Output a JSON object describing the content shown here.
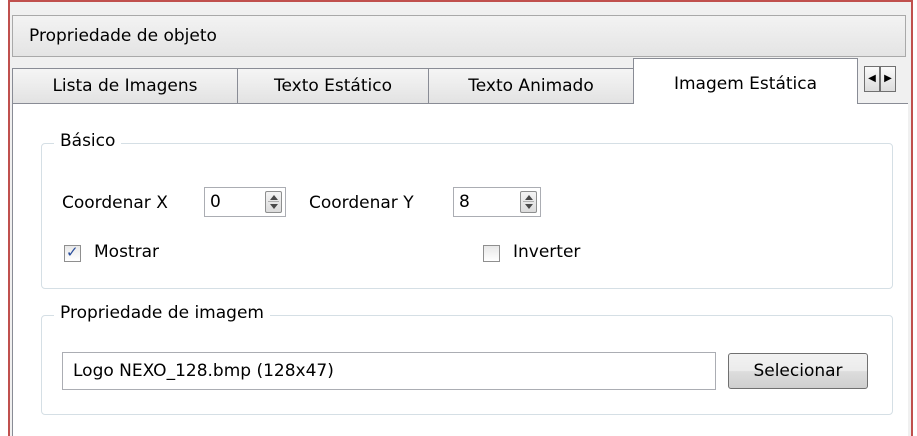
{
  "panel": {
    "title": "Propriedade de objeto"
  },
  "tabs": [
    {
      "label": "Lista de Imagens",
      "active": false
    },
    {
      "label": "Texto Estático",
      "active": false
    },
    {
      "label": "Texto Animado",
      "active": false
    },
    {
      "label": "Imagem Estática",
      "active": true
    }
  ],
  "basic": {
    "legend": "Básico",
    "coord_x_label": "Coordenar X",
    "coord_x_value": "0",
    "coord_y_label": "Coordenar Y",
    "coord_y_value": "8",
    "show_label": "Mostrar",
    "show_checked": true,
    "invert_label": "Inverter",
    "invert_checked": false
  },
  "image": {
    "legend": "Propriedade de imagem",
    "file_value": "Logo NEXO_128.bmp (128x47)",
    "select_label": "Selecionar"
  },
  "icons": {
    "tab_left": "left-arrow-icon",
    "tab_right": "right-arrow-icon"
  }
}
